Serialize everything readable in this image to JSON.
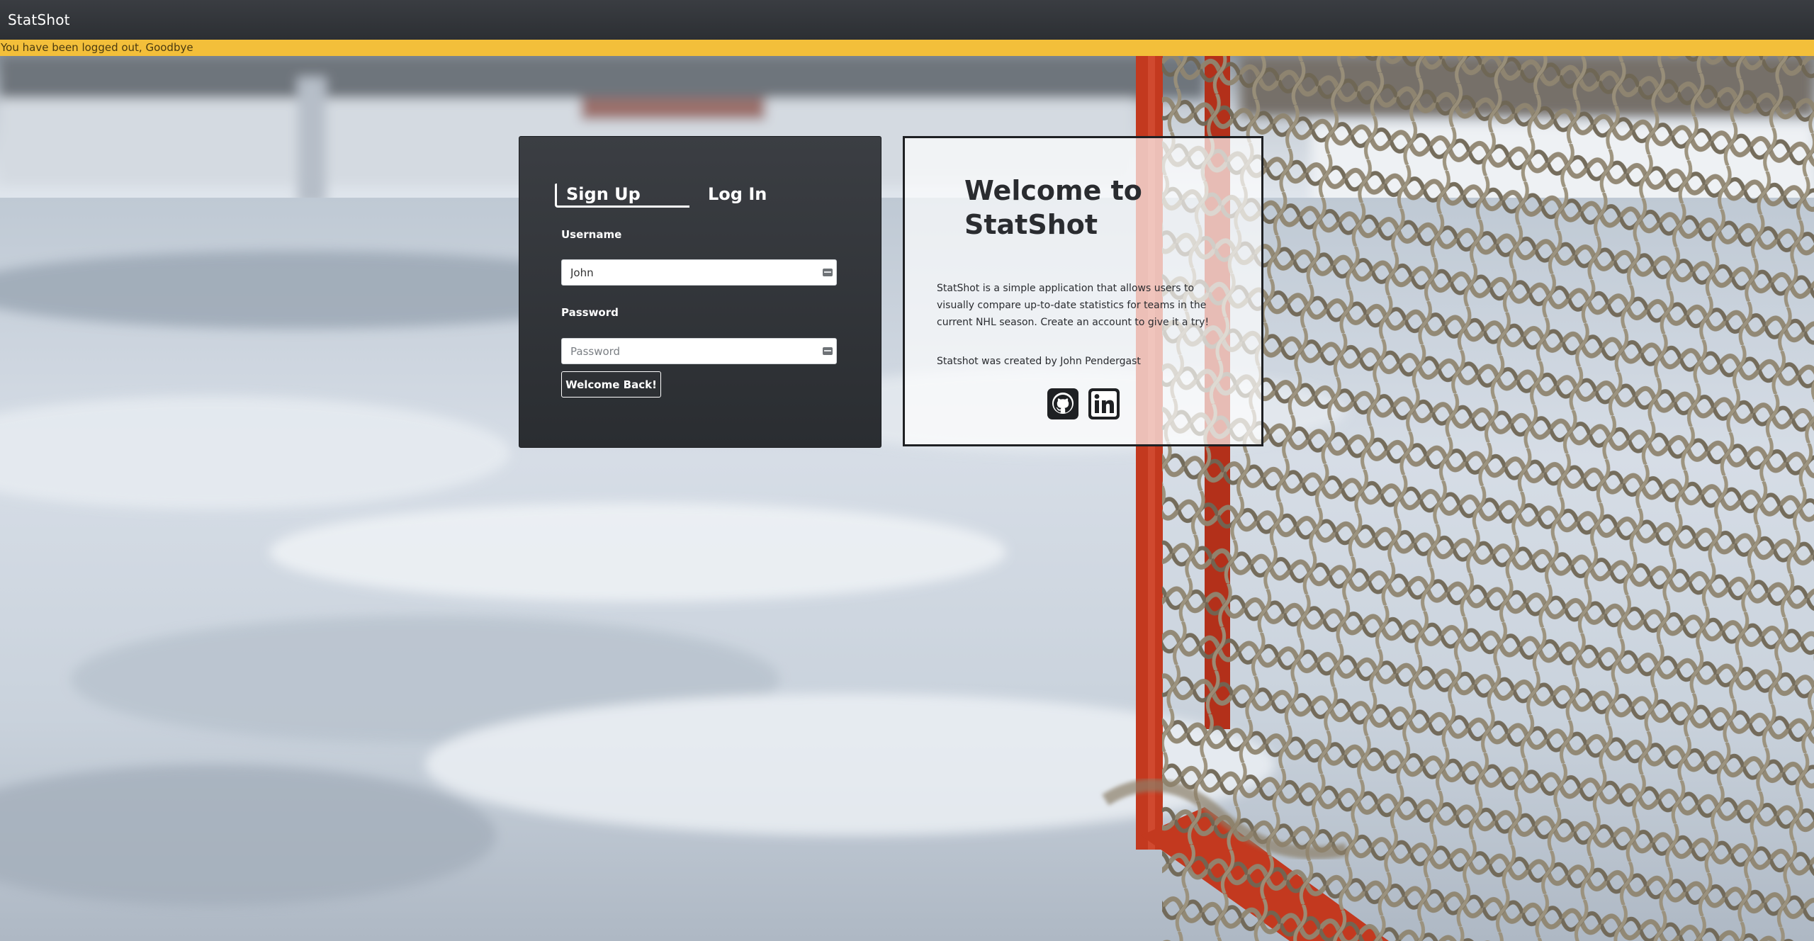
{
  "navbar": {
    "brand": "StatShot"
  },
  "flash": {
    "message": "You have been logged out, Goodbye",
    "color": "#f3bf3a"
  },
  "background": {
    "scene": "outdoor-ice-rink-with-hockey-net"
  },
  "auth": {
    "tabs": [
      {
        "label": "Sign Up",
        "active": true
      },
      {
        "label": "Log In",
        "active": false
      }
    ],
    "username_label": "Username",
    "username_value": "John",
    "password_label": "Password",
    "password_placeholder": "Password",
    "submit_label": "Welcome Back!"
  },
  "welcome": {
    "title": "Welcome to StatShot",
    "description": "StatShot is a simple application that allows users to visually compare up-to-date statistics for teams in the current NHL season. Create an account to give it a try!",
    "credit": "Statshot was created by John Pendergast",
    "social": [
      {
        "name": "github",
        "icon": "github-icon"
      },
      {
        "name": "linkedin",
        "icon": "linkedin-icon"
      }
    ]
  }
}
